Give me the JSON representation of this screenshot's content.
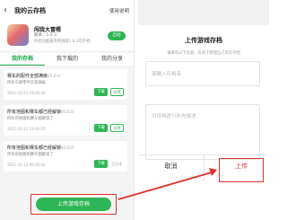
{
  "left": {
    "back_icon": "‹",
    "title": "我的云存档",
    "help": "使用说明",
    "game": {
      "name": "闯我大冒嗯",
      "version": "版本：1.0.3",
      "desc": "存档功能服务特别版1.0.3可存档",
      "launch": "启动"
    },
    "tabs": [
      "我的存档",
      "我下载的",
      "我的分享"
    ],
    "saves": [
      {
        "title": "赛车的配件全部满级",
        "version": "V1.0.0",
        "desc": "所有车辆零件全部满级",
        "date": "2021-10-22 19:30:20",
        "download": "下载",
        "action": "分享"
      },
      {
        "title": "所有地图和赛车都已经解锁",
        "version": "V1.0.0",
        "desc": "所有的地图和赛车都解锁了",
        "date": "2021-10-22 19:30:20",
        "download": "下载",
        "action": "分享"
      },
      {
        "title": "所有地图和赛车都已经解锁",
        "version": "V1.0.0",
        "desc": "所有的地图和赛车都解锁了",
        "date": "2021-10-12 09:30:00",
        "download": "下载",
        "action": "已分享"
      }
    ],
    "upload_button": "上传游戏存档"
  },
  "dialog": {
    "title": "上传游戏存档",
    "hint": "请填写以下信息，有利于管理自己的云存档",
    "name_placeholder": "请输入存档名",
    "desc_placeholder": "对存档进行补充描述",
    "cancel": "取消",
    "upload": "上传"
  },
  "colors": {
    "accent": "#2db555",
    "highlight": "#e0312a"
  }
}
